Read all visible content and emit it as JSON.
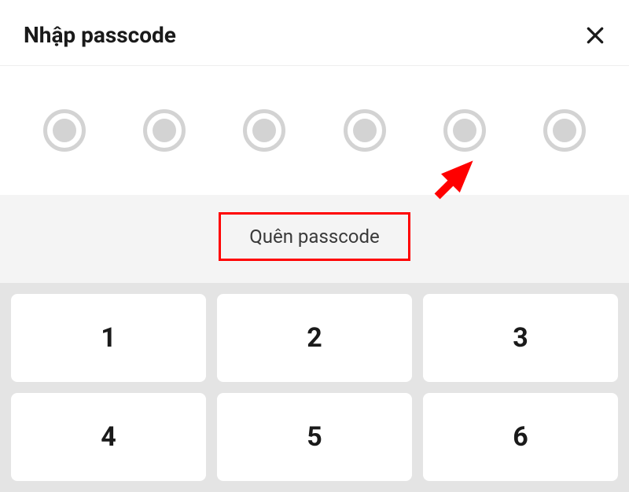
{
  "header": {
    "title": "Nhập passcode"
  },
  "passcode": {
    "digits": 6
  },
  "forgot": {
    "label": "Quên passcode"
  },
  "keypad": {
    "keys": [
      "1",
      "2",
      "3",
      "4",
      "5",
      "6"
    ]
  },
  "annotation": {
    "arrow_color": "#ff0000",
    "highlight_color": "#ff0000"
  }
}
